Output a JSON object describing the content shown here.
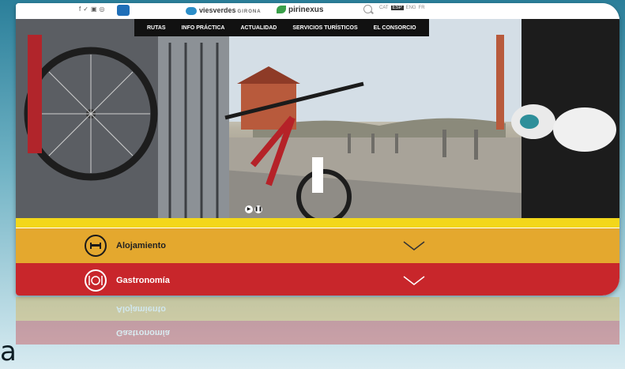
{
  "topbar": {
    "social_icons": [
      "facebook-icon",
      "twitter-icon",
      "youtube-icon",
      "instagram-icon"
    ],
    "brand_primary": "viesverdes",
    "brand_primary_suffix": "GIRONA",
    "brand_secondary": "pirinexus",
    "languages": [
      "CAT",
      "ESP",
      "ENG",
      "FR"
    ],
    "active_language": "ESP"
  },
  "nav": {
    "items": [
      "RUTAS",
      "INFO PRÁCTICA",
      "ACTUALIDAD",
      "SERVICIOS TURÍSTICOS",
      "EL CONSORCIO"
    ]
  },
  "hero": {
    "controls": [
      "play-icon",
      "pause-icon"
    ]
  },
  "sections": [
    {
      "label": "Alojamiento",
      "icon": "bed-icon",
      "color": "#e4a82e"
    },
    {
      "label": "Gastronomía",
      "icon": "dining-icon",
      "color": "#c8262b"
    }
  ],
  "reflection_labels": [
    "Gastronomía",
    "Alojamiento"
  ],
  "corner_glyph": "a",
  "colors": {
    "accent": "#f3d71a",
    "nav_bg": "#111111"
  }
}
